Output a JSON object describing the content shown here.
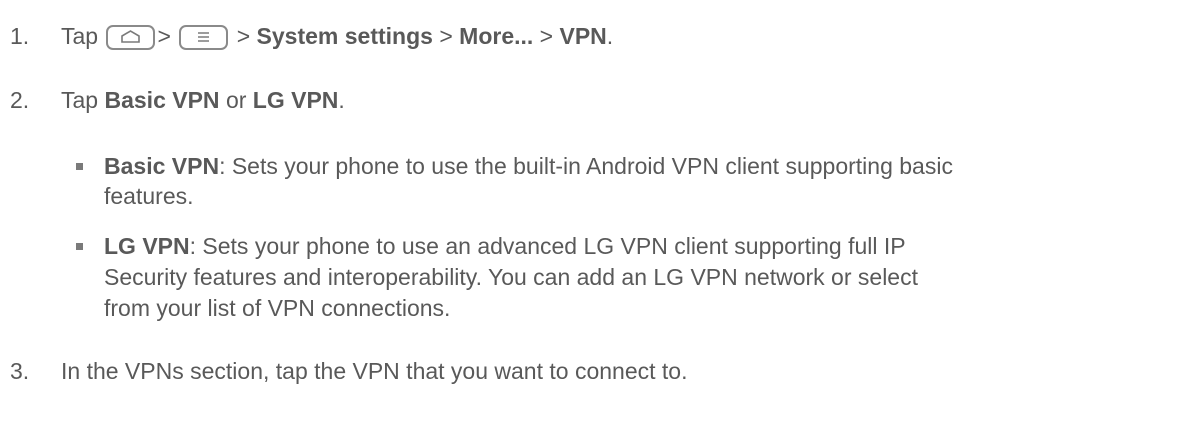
{
  "steps": [
    {
      "number": "1.",
      "tap": "Tap",
      "sep": ">",
      "path": [
        "System settings",
        "More...",
        "VPN"
      ],
      "end": "."
    },
    {
      "number": "2.",
      "tap": "Tap",
      "option_a": "Basic VPN",
      "or": "or",
      "option_b": "LG VPN",
      "end": "."
    },
    {
      "number": "3.",
      "text": "In the VPNs section, tap the VPN that you want to connect to."
    }
  ],
  "bullets": [
    {
      "term": "Basic VPN",
      "lines": [
        ": Sets your phone to use the built-in Android VPN client supporting basic",
        "features."
      ]
    },
    {
      "term": "LG VPN",
      "lines": [
        ": Sets your phone to use an advanced LG VPN client supporting full IP",
        "Security features and interoperability. You can add an LG VPN network or select",
        "from your list of VPN connections."
      ]
    }
  ],
  "icons": {
    "home_key": "home-key-icon",
    "menu_key": "menu-key-icon"
  }
}
